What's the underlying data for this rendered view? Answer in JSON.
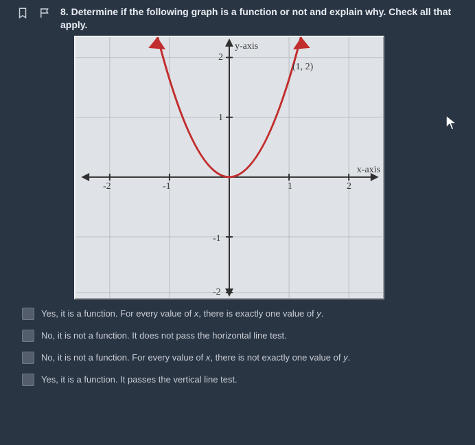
{
  "question": {
    "number": "8.",
    "text": "Determine if the following graph is a function or not and explain why. Check all that apply."
  },
  "plot": {
    "y_axis_label": "y-axis",
    "x_axis_label": "x-axis",
    "point_label": "(1, 2)",
    "ticks": {
      "y2": "2",
      "y1": "1",
      "yn1": "-1",
      "yn2": "-2",
      "x2": "2",
      "x1": "1",
      "xn1": "-1",
      "xn2": "-2"
    }
  },
  "options": {
    "a_pre": "Yes, it is a function. For every value of ",
    "a_var": "x",
    "a_mid": ", there is exactly one value of ",
    "a_var2": "y",
    "a_post": ".",
    "b": "No, it is not a function. It does not pass the horizontal line test.",
    "c_pre": "No, it is not a function. For every value of ",
    "c_var": "x",
    "c_mid": ", there is not exactly one value of ",
    "c_var2": "y",
    "c_post": ".",
    "d": "Yes, it is a function. It passes the vertical line test."
  },
  "chart_data": {
    "type": "line",
    "title": "",
    "xlabel": "x-axis",
    "ylabel": "y-axis",
    "xlim": [
      -2.3,
      2.3
    ],
    "ylim": [
      -2.3,
      2.3
    ],
    "grid": true,
    "series": [
      {
        "name": "curve",
        "x": [
          -1.2,
          -1.0,
          -0.8,
          -0.6,
          -0.4,
          -0.2,
          0.0,
          0.2,
          0.4,
          0.6,
          0.8,
          1.0,
          1.2
        ],
        "y": [
          2.88,
          2.0,
          1.28,
          0.72,
          0.32,
          0.08,
          0.0,
          0.08,
          0.32,
          0.72,
          1.28,
          2.0,
          2.88
        ]
      }
    ],
    "annotations": [
      {
        "type": "point-label",
        "x": 1,
        "y": 2,
        "text": "(1, 2)"
      }
    ]
  }
}
